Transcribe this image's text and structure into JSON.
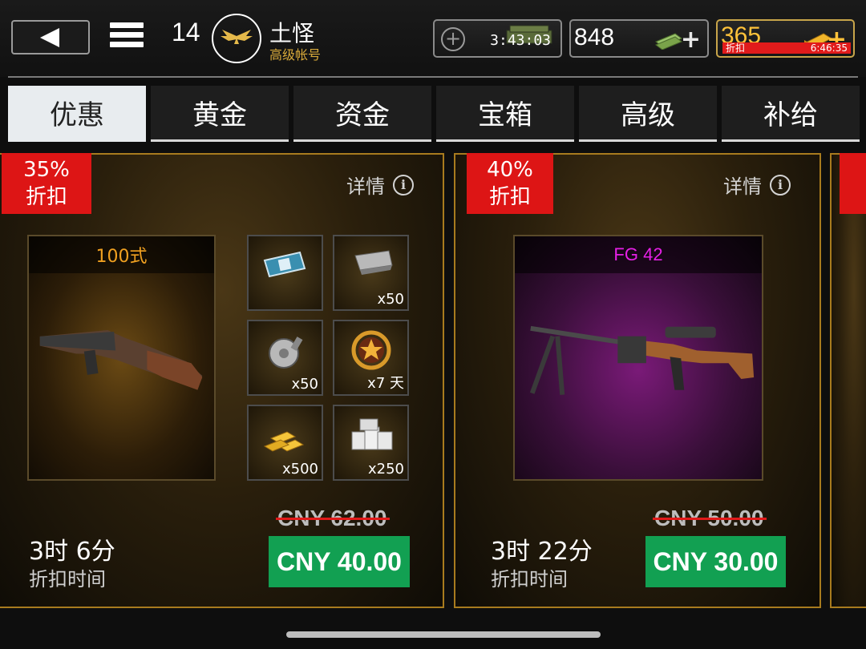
{
  "header": {
    "level": "14",
    "player_name": "土怪",
    "account_type": "高级帐号",
    "crate_timer": "3:43:03",
    "cash_amount": "848",
    "gold_amount": "365",
    "gold_sale_label": "折扣",
    "gold_sale_timer": "6:46:35"
  },
  "tabs": [
    {
      "label": "优惠",
      "active": true
    },
    {
      "label": "黄金",
      "active": false
    },
    {
      "label": "资金",
      "active": false
    },
    {
      "label": "宝箱",
      "active": false
    },
    {
      "label": "高级",
      "active": false
    },
    {
      "label": "补给",
      "active": false
    }
  ],
  "offers": [
    {
      "discount_pct": "35%",
      "discount_label": "折扣",
      "details_label": "详情",
      "weapon_name": "100式",
      "rewards": [
        {
          "icon": "medal-ribbon-icon",
          "qty": ""
        },
        {
          "icon": "ammo-clip-icon",
          "qty": "x50"
        },
        {
          "icon": "drum-magazine-icon",
          "qty": "x50"
        },
        {
          "icon": "star-laurel-icon",
          "qty": "x7 天"
        },
        {
          "icon": "gold-bars-icon",
          "qty": "x500"
        },
        {
          "icon": "cash-stacks-icon",
          "qty": "x250"
        }
      ],
      "old_price": "CNY 62.00",
      "new_price": "CNY 40.00",
      "time_left": "3时 6分",
      "time_label": "折扣时间"
    },
    {
      "discount_pct": "40%",
      "discount_label": "折扣",
      "details_label": "详情",
      "weapon_name": "FG 42",
      "old_price": "CNY 50.00",
      "new_price": "CNY 30.00",
      "time_left": "3时 22分",
      "time_label": "折扣时间"
    }
  ],
  "colors": {
    "discount_red": "#dd1515",
    "buy_green": "#12a052",
    "card_border": "#a87b1e",
    "gold_text": "#ffc23a"
  }
}
